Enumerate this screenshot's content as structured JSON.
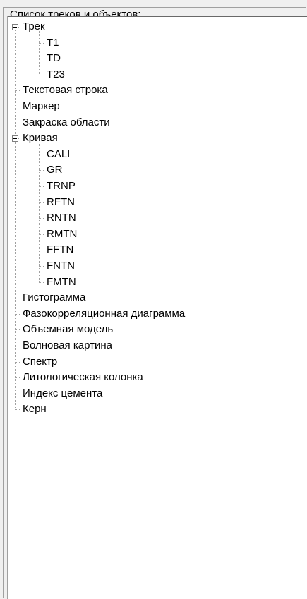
{
  "groupbox": {
    "title": "Список треков и объектов:"
  },
  "tree": [
    {
      "label": "Трек",
      "expanded": true,
      "children": [
        {
          "label": "T1"
        },
        {
          "label": "TD"
        },
        {
          "label": "T23"
        }
      ]
    },
    {
      "label": "Текстовая строка"
    },
    {
      "label": "Маркер"
    },
    {
      "label": "Закраска области"
    },
    {
      "label": "Кривая",
      "expanded": true,
      "children": [
        {
          "label": "CALI"
        },
        {
          "label": "GR"
        },
        {
          "label": "TRNP"
        },
        {
          "label": "RFTN"
        },
        {
          "label": "RNTN"
        },
        {
          "label": "RMTN"
        },
        {
          "label": "FFTN"
        },
        {
          "label": "FNTN"
        },
        {
          "label": "FMTN"
        }
      ]
    },
    {
      "label": "Гистограмма"
    },
    {
      "label": "Фазокорреляционная диаграмма"
    },
    {
      "label": "Объемная модель"
    },
    {
      "label": "Волновая картина"
    },
    {
      "label": "Спектр"
    },
    {
      "label": "Литологическая колонка"
    },
    {
      "label": "Индекс цемента"
    },
    {
      "label": "Керн"
    }
  ],
  "colors": {
    "dotted_line": "#a0a0a0",
    "expander_border": "#7f7f7f",
    "window_bg": "#f0f0f0",
    "tree_bg": "#ffffff"
  },
  "icons": {
    "expander": "minus-box-icon"
  }
}
